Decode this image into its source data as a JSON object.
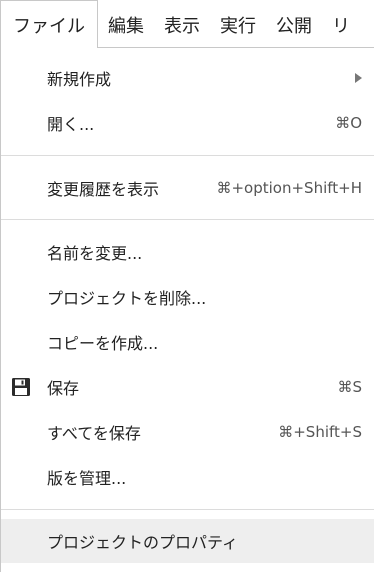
{
  "menubar": {
    "items": [
      "ファイル",
      "編集",
      "表示",
      "実行",
      "公開",
      "リ"
    ]
  },
  "menu": {
    "new": "新規作成",
    "open": "開く...",
    "open_shortcut": "⌘O",
    "history": "変更履歴を表示",
    "history_shortcut": "⌘+option+Shift+H",
    "rename": "名前を変更...",
    "delete": "プロジェクトを削除...",
    "copy": "コピーを作成...",
    "save": "保存",
    "save_shortcut": "⌘S",
    "save_all": "すべてを保存",
    "save_all_shortcut": "⌘+Shift+S",
    "versions": "版を管理...",
    "properties": "プロジェクトのプロパティ"
  },
  "icons": {
    "save": "floppy-disk-icon",
    "submenu": "submenu-arrow-icon"
  },
  "colors": {
    "highlight": "#eeeeee",
    "border": "#c8c8c8",
    "separator": "#dcdcdc"
  }
}
